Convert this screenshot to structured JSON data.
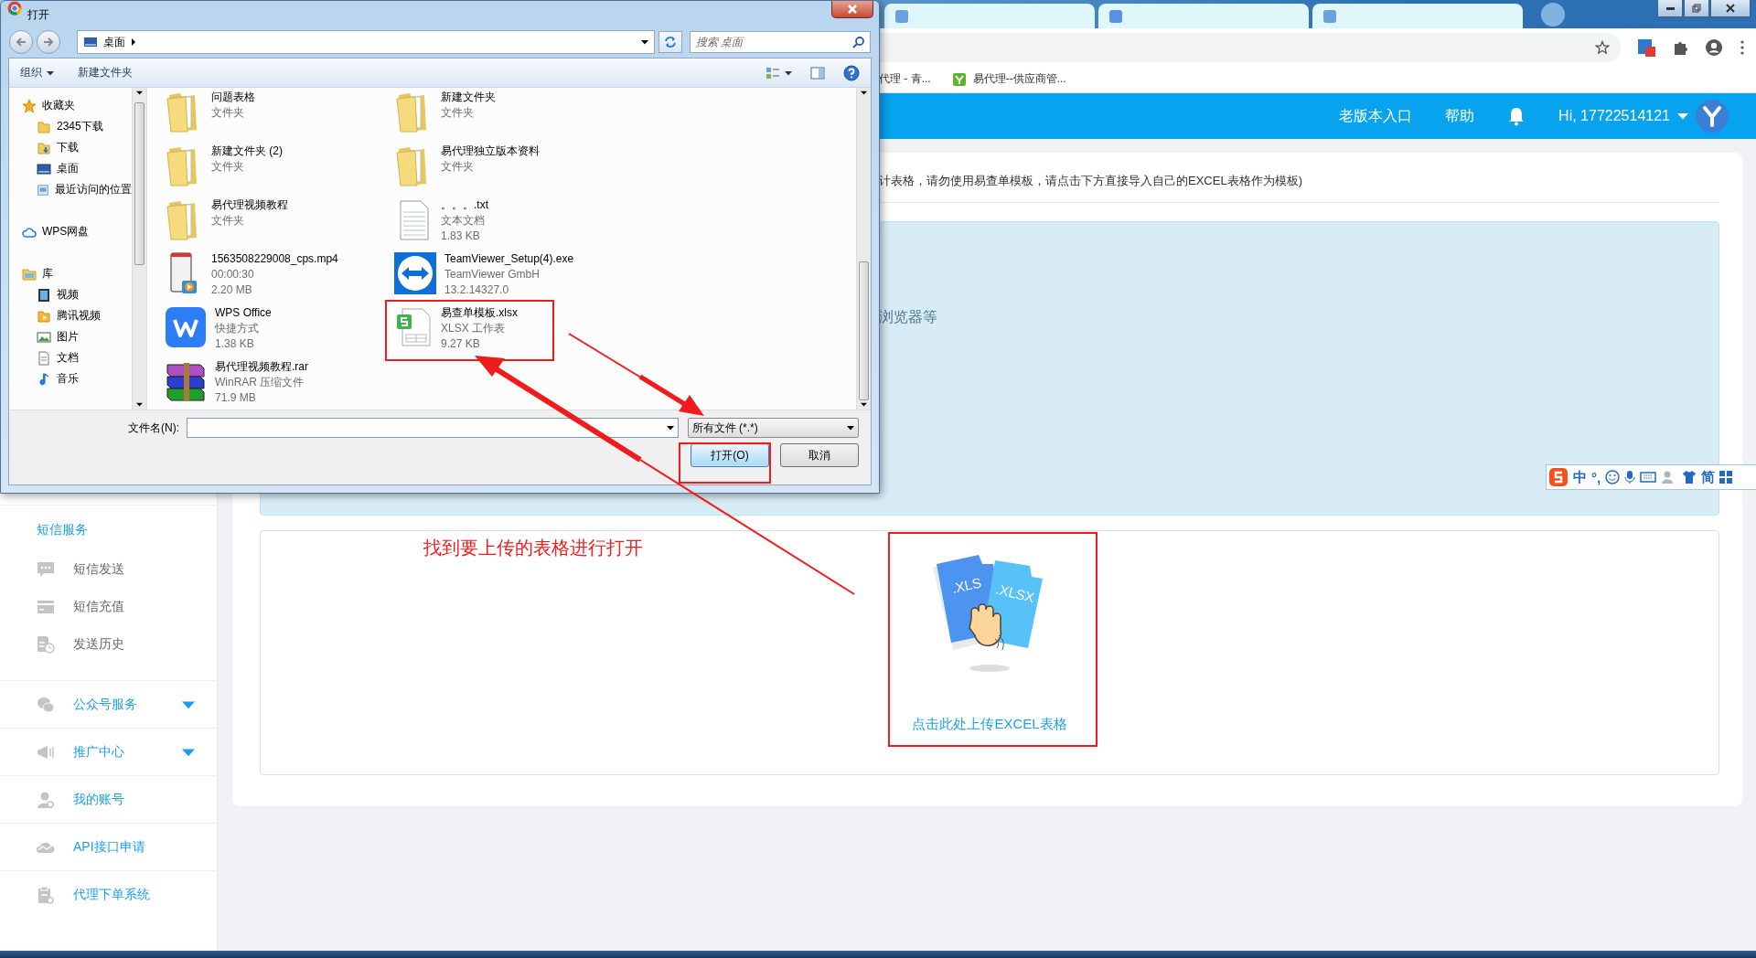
{
  "browser": {
    "bookmarks": [
      {
        "label": "代理 - 青...",
        "favicon": false
      },
      {
        "label": "易代理--供应商管...",
        "favicon": true
      }
    ]
  },
  "header": {
    "links": [
      "老版本入口",
      "帮助"
    ],
    "user": "Hi, 17722514121"
  },
  "sidebar": [
    {
      "kind": "section",
      "label": "短信服务",
      "items": [
        {
          "label": "短信发送"
        },
        {
          "label": "短信充值"
        },
        {
          "label": "发送历史"
        }
      ]
    },
    {
      "kind": "submenu",
      "label": "公众号服务"
    },
    {
      "kind": "submenu",
      "label": "推广中心"
    },
    {
      "kind": "link",
      "label": "我的账号"
    },
    {
      "kind": "link",
      "label": "API接口申请"
    },
    {
      "kind": "link",
      "label": "代理下单系统"
    }
  ],
  "main": {
    "notice": "计表格，请勿使用易查单模板，请点击下方直接导入自己的EXCEL表格作为模板)",
    "tip": "浏览器等",
    "upload": {
      "file_labels": [
        ".XLS",
        ".XLSX"
      ],
      "link": "点击此处上传EXCEL表格"
    }
  },
  "dialog": {
    "title": "打开",
    "location": "桌面",
    "search": {
      "placeholder": "搜索 桌面"
    },
    "toolbar": [
      "组织",
      "新建文件夹"
    ],
    "nav": [
      {
        "label": "收藏夹",
        "children": [
          {
            "label": "2345下载"
          },
          {
            "label": "下载"
          },
          {
            "label": "桌面"
          },
          {
            "label": "最近访问的位置"
          }
        ]
      },
      {
        "label": "WPS网盘"
      },
      {
        "label": "库",
        "children": [
          {
            "label": "视频"
          },
          {
            "label": "腾讯视频"
          },
          {
            "label": "图片"
          },
          {
            "label": "文档"
          },
          {
            "label": "音乐"
          }
        ]
      }
    ],
    "files": [
      {
        "name": "问题表格",
        "kind": "folder",
        "details": [
          "文件夹"
        ]
      },
      {
        "name": "新建文件夹",
        "kind": "folder",
        "details": [
          "文件夹"
        ]
      },
      {
        "name": "新建文件夹 (2)",
        "kind": "folder",
        "details": [
          "文件夹"
        ]
      },
      {
        "name": "易代理独立版本资料",
        "kind": "folder",
        "details": [
          "文件夹"
        ]
      },
      {
        "name": "易代理视频教程",
        "kind": "folder",
        "details": [
          "文件夹"
        ]
      },
      {
        "name": "。。。.txt",
        "kind": "text",
        "details": [
          "文本文档",
          "1.83 KB"
        ]
      },
      {
        "name": "1563508229008_cps.mp4",
        "kind": "video",
        "details": [
          "00:00:30",
          "2.20 MB"
        ]
      },
      {
        "name": "TeamViewer_Setup(4).exe",
        "kind": "exe",
        "details": [
          "TeamViewer GmbH",
          "13.2.14327.0"
        ]
      },
      {
        "name": "WPS Office",
        "kind": "shortcut",
        "details": [
          "快捷方式",
          "1.38 KB"
        ]
      },
      {
        "name": "易查单模板.xlsx",
        "kind": "sheet",
        "details": [
          "XLSX 工作表",
          "9.27 KB"
        ]
      },
      {
        "name": "易代理视频教程.rar",
        "kind": "archive",
        "details": [
          "WinRAR 压缩文件",
          "71.9 MB"
        ]
      }
    ],
    "file_name_label": "文件名(N):",
    "file_type": "所有文件 (*.*)",
    "buttons": [
      {
        "label": "打开(O)",
        "kind": "primary"
      },
      {
        "label": "取消",
        "kind": "secondary"
      }
    ]
  },
  "annotation": {
    "note": "找到要上传的表格进行打开"
  },
  "ime_toolbar": {
    "mode": "中",
    "punctuation": "°,",
    "script": "简"
  }
}
